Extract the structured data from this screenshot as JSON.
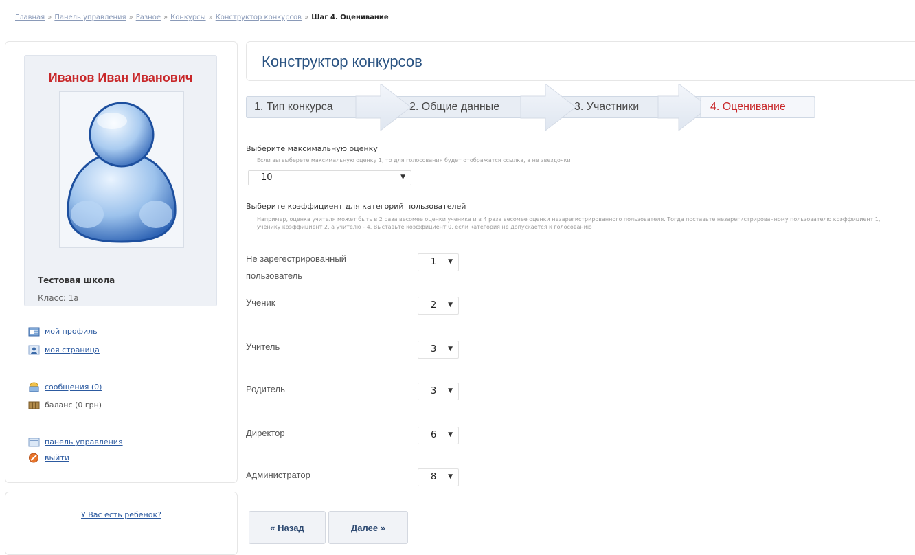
{
  "breadcrumb": {
    "items": [
      "Главная",
      "Панель управления",
      "Разное",
      "Конкурсы",
      "Конструктор конкурсов"
    ],
    "separator": "»",
    "current": "Шаг 4. Оценивание"
  },
  "sidebar": {
    "user_name": "Иванов Иван Иванович",
    "school": "Тестовая школа",
    "class_label": "Класс: 1а",
    "links": {
      "profile": "мой профиль",
      "my_page": "моя страница",
      "messages": "сообщения (0)",
      "balance": "баланс (0 грн)",
      "control_panel": "панель управления",
      "logout": "выйти"
    },
    "child_link": "У Вас есть ребенок?"
  },
  "main": {
    "title": "Конструктор конкурсов",
    "steps": [
      {
        "label": "1. Тип конкурса",
        "active": false
      },
      {
        "label": "2. Общие данные",
        "active": false
      },
      {
        "label": "3. Участники",
        "active": false
      },
      {
        "label": "4. Оценивание",
        "active": true
      }
    ],
    "max_score": {
      "label": "Выберите максимальную оценку",
      "hint": "Если вы выберете максимальную оценку 1, то для голосования будет отображатся ссылка, а не звездочки",
      "value": "10"
    },
    "coefficients": {
      "label": "Выберите коэффициент для категорий пользователей",
      "hint": "Например, оценка учителя может быть в 2 раза весомее оценки ученика и в 4 раза весомее оценки незарегистрированного пользователя. Тогда поставьте незарегистрированному пользователю коэффициент 1, ученику коэффициент 2, а учителю - 4. Выставьте коэффициент 0, если категория не допускается к голосованию",
      "categories": [
        {
          "label": "Не зарегестрированный пользователь",
          "value": "1"
        },
        {
          "label": "Ученик",
          "value": "2"
        },
        {
          "label": "Учитель",
          "value": "3"
        },
        {
          "label": "Родитель",
          "value": "3"
        },
        {
          "label": "Директор",
          "value": "6"
        },
        {
          "label": "Администратор",
          "value": "8"
        }
      ]
    },
    "buttons": {
      "back": "« Назад",
      "next": "Далее »"
    }
  },
  "icons": {
    "profile": "id-card-icon",
    "my_page": "user-page-icon",
    "messages": "envelope-icon",
    "balance": "wallet-icon",
    "control_panel": "panel-icon",
    "logout": "exit-icon",
    "dropdown": "chevron-down-icon"
  },
  "colors": {
    "accent_red": "#c8282a",
    "title_blue": "#2a5382",
    "link_blue": "#2c5aa0"
  }
}
